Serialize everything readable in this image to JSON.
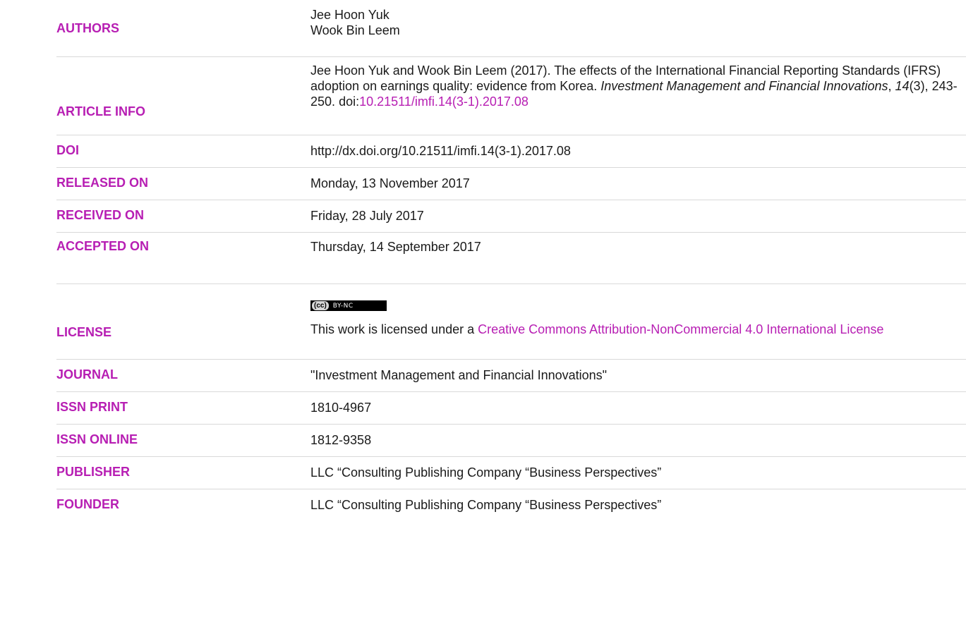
{
  "authors": {
    "label": "AUTHORS",
    "names": [
      "Jee Hoon Yuk",
      "Wook Bin Leem"
    ]
  },
  "article_info": {
    "label": "ARTICLE INFO",
    "citation_prefix": "Jee Hoon Yuk and Wook Bin Leem (2017). The effects of the International Financial Reporting Standards (IFRS) adoption on earnings quality: evidence from Korea. ",
    "journal_italic": "Investment Management and Financial Innovations",
    "comma": ", ",
    "volume_italic": "14",
    "pages": "(3), 243-250.",
    "doi_prefix": "doi:",
    "doi_link": "10.21511/imfi.14(3-1).2017.08"
  },
  "doi": {
    "label": "DOI",
    "value": "http://dx.doi.org/10.21511/imfi.14(3-1).2017.08"
  },
  "released": {
    "label": "RELEASED ON",
    "value": "Monday, 13 November 2017"
  },
  "received": {
    "label": "RECEIVED ON",
    "value": "Friday, 28 July 2017"
  },
  "accepted": {
    "label": "ACCEPTED ON",
    "value": "Thursday, 14 September 2017"
  },
  "license": {
    "label": "LICENSE",
    "badge_cc": "(cc)",
    "badge_text": "BY-NC",
    "text_prefix": "This work is licensed under a ",
    "link_text": "Creative Commons Attribution-NonCommercial 4.0 International License"
  },
  "journal": {
    "label": "JOURNAL",
    "value": "\"Investment Management and Financial Innovations\""
  },
  "issn_print": {
    "label": "ISSN PRINT",
    "value": "1810-4967"
  },
  "issn_online": {
    "label": "ISSN ONLINE",
    "value": "1812-9358"
  },
  "publisher": {
    "label": "PUBLISHER",
    "value": "LLC “Consulting Publishing Company “Business Perspectives”"
  },
  "founder": {
    "label": "FOUNDER",
    "value": "LLC “Consulting Publishing Company “Business Perspectives”"
  },
  "colors": {
    "accent": "#b71eb3",
    "divider": "#d9d9d9",
    "text": "#1a1a1a"
  }
}
